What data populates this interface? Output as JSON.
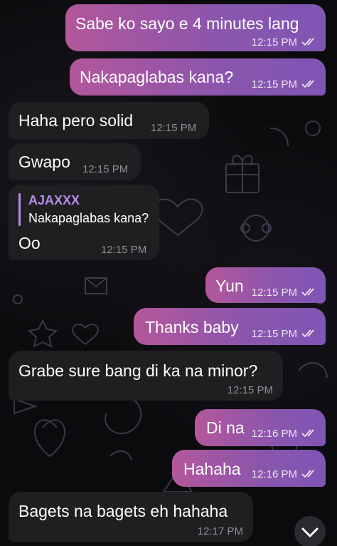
{
  "colors": {
    "outgoing_start": "#b3579b",
    "outgoing_end": "#7f55b5",
    "incoming": "#1f1f22",
    "reply_accent": "#b98be8",
    "background": "#0b0b0d"
  },
  "messages": [
    {
      "direction": "outgoing",
      "text": "Sabe ko sayo e 4 minutes lang",
      "time": "12:15 PM",
      "read_ticks": "double-check-icon"
    },
    {
      "direction": "outgoing",
      "text": "Nakapaglabas kana?",
      "time": "12:15 PM",
      "read_ticks": "double-check-icon"
    },
    {
      "direction": "incoming",
      "text": "Haha pero solid",
      "time": "12:15 PM"
    },
    {
      "direction": "incoming",
      "text": "Gwapo",
      "time": "12:15 PM"
    },
    {
      "direction": "incoming",
      "reply_to": {
        "name": "AJAXXX",
        "text": "Nakapaglabas kana?"
      },
      "text": "Oo",
      "time": "12:15 PM"
    },
    {
      "direction": "outgoing",
      "text": "Yun",
      "time": "12:15 PM",
      "read_ticks": "double-check-icon"
    },
    {
      "direction": "outgoing",
      "text": "Thanks baby",
      "time": "12:15 PM",
      "read_ticks": "double-check-icon"
    },
    {
      "direction": "incoming",
      "text": "Grabe sure bang di ka na minor?",
      "time": "12:15 PM"
    },
    {
      "direction": "outgoing",
      "text": "Di na",
      "time": "12:16 PM",
      "read_ticks": "double-check-icon"
    },
    {
      "direction": "outgoing",
      "text": "Hahaha",
      "time": "12:16 PM",
      "read_ticks": "double-check-icon"
    },
    {
      "direction": "incoming",
      "text": "Bagets na bagets eh hahaha",
      "time": "12:17 PM"
    }
  ],
  "scroll_down_icon": "chevron-down-icon"
}
